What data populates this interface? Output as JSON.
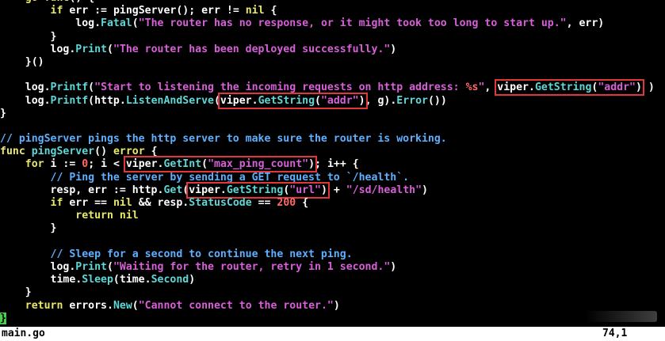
{
  "code_lines": [
    [
      {
        "t": "    ",
        "c": "plain"
      },
      {
        "t": "go",
        "c": "kw"
      },
      {
        "t": " ",
        "c": "plain"
      },
      {
        "t": "func",
        "c": "kw"
      },
      {
        "t": "() {",
        "c": "plain"
      }
    ],
    [
      {
        "t": "        ",
        "c": "plain"
      },
      {
        "t": "if",
        "c": "kw"
      },
      {
        "t": " err := ",
        "c": "plain"
      },
      {
        "t": "pingServer",
        "c": "plain"
      },
      {
        "t": "(); err != ",
        "c": "plain"
      },
      {
        "t": "nil",
        "c": "kw"
      },
      {
        "t": " {",
        "c": "plain"
      }
    ],
    [
      {
        "t": "            log.",
        "c": "plain"
      },
      {
        "t": "Fatal",
        "c": "fn"
      },
      {
        "t": "(",
        "c": "plain"
      },
      {
        "t": "\"The router has no response, or it might took too long to start up.\"",
        "c": "str"
      },
      {
        "t": ", err)",
        "c": "plain"
      }
    ],
    [
      {
        "t": "        }",
        "c": "plain"
      }
    ],
    [
      {
        "t": "        log.",
        "c": "plain"
      },
      {
        "t": "Print",
        "c": "fn"
      },
      {
        "t": "(",
        "c": "plain"
      },
      {
        "t": "\"The router has been deployed successfully.\"",
        "c": "str"
      },
      {
        "t": ")",
        "c": "plain"
      }
    ],
    [
      {
        "t": "    }()",
        "c": "plain"
      }
    ],
    [
      {
        "t": "",
        "c": "plain"
      }
    ],
    [
      {
        "t": "    log.",
        "c": "plain"
      },
      {
        "t": "Printf",
        "c": "fn"
      },
      {
        "t": "(",
        "c": "plain"
      },
      {
        "t": "\"Start to listening the incoming requests on http address: ",
        "c": "str"
      },
      {
        "t": "%s",
        "c": "fmt"
      },
      {
        "t": "\"",
        "c": "str"
      },
      {
        "t": ", ",
        "c": "plain"
      },
      {
        "t": "viper.",
        "c": "plain",
        "box": "start"
      },
      {
        "t": "GetString",
        "c": "fn"
      },
      {
        "t": "(",
        "c": "plain"
      },
      {
        "t": "\"addr\"",
        "c": "str"
      },
      {
        "t": ")",
        "c": "plain",
        "box": "end"
      },
      {
        "t": " )",
        "c": "plain"
      }
    ],
    [
      {
        "t": "    log.",
        "c": "plain"
      },
      {
        "t": "Printf",
        "c": "fn"
      },
      {
        "t": "(http.",
        "c": "plain"
      },
      {
        "t": "ListenAndServe",
        "c": "fn"
      },
      {
        "t": "(",
        "c": "plain"
      },
      {
        "t": "viper.",
        "c": "plain",
        "box": "start"
      },
      {
        "t": "GetString",
        "c": "fn"
      },
      {
        "t": "(",
        "c": "plain"
      },
      {
        "t": "\"addr\"",
        "c": "str"
      },
      {
        "t": ")",
        "c": "plain",
        "box": "end"
      },
      {
        "t": ", g).",
        "c": "plain"
      },
      {
        "t": "Error",
        "c": "fn"
      },
      {
        "t": "())",
        "c": "plain"
      }
    ],
    [
      {
        "t": "}",
        "c": "plain"
      }
    ],
    [
      {
        "t": "",
        "c": "plain"
      }
    ],
    [
      {
        "t": "// pingServer pings the http server to make sure the router is working.",
        "c": "cm"
      }
    ],
    [
      {
        "t": "func",
        "c": "kw"
      },
      {
        "t": " ",
        "c": "plain"
      },
      {
        "t": "pingServer",
        "c": "fn"
      },
      {
        "t": "() ",
        "c": "plain"
      },
      {
        "t": "error",
        "c": "kw"
      },
      {
        "t": " {",
        "c": "plain"
      }
    ],
    [
      {
        "t": "    ",
        "c": "plain"
      },
      {
        "t": "for",
        "c": "kw"
      },
      {
        "t": " i := ",
        "c": "plain"
      },
      {
        "t": "0",
        "c": "num"
      },
      {
        "t": "; i < ",
        "c": "plain"
      },
      {
        "t": "viper.",
        "c": "plain",
        "box": "start"
      },
      {
        "t": "GetInt",
        "c": "fn"
      },
      {
        "t": "(",
        "c": "plain"
      },
      {
        "t": "\"max_ping_count\"",
        "c": "str"
      },
      {
        "t": ")",
        "c": "plain",
        "box": "end"
      },
      {
        "t": "; i++ {",
        "c": "plain"
      }
    ],
    [
      {
        "t": "        ",
        "c": "plain"
      },
      {
        "t": "// Ping the server by sending a GET request to `/health`.",
        "c": "cm"
      }
    ],
    [
      {
        "t": "        resp, err := http.",
        "c": "plain"
      },
      {
        "t": "Get",
        "c": "fn"
      },
      {
        "t": "(",
        "c": "plain"
      },
      {
        "t": "viper.",
        "c": "plain",
        "box": "start"
      },
      {
        "t": "GetString",
        "c": "fn"
      },
      {
        "t": "(",
        "c": "plain"
      },
      {
        "t": "\"url\"",
        "c": "str"
      },
      {
        "t": ")",
        "c": "plain",
        "box": "end"
      },
      {
        "t": " + ",
        "c": "plain"
      },
      {
        "t": "\"/sd/health\"",
        "c": "str"
      },
      {
        "t": ")",
        "c": "plain"
      }
    ],
    [
      {
        "t": "        ",
        "c": "plain"
      },
      {
        "t": "if",
        "c": "kw"
      },
      {
        "t": " err == ",
        "c": "plain"
      },
      {
        "t": "nil",
        "c": "kw"
      },
      {
        "t": " && resp.",
        "c": "plain"
      },
      {
        "t": "StatusCode",
        "c": "fn"
      },
      {
        "t": " == ",
        "c": "plain"
      },
      {
        "t": "200",
        "c": "num"
      },
      {
        "t": " {",
        "c": "plain"
      }
    ],
    [
      {
        "t": "            ",
        "c": "plain"
      },
      {
        "t": "return",
        "c": "kw"
      },
      {
        "t": " ",
        "c": "plain"
      },
      {
        "t": "nil",
        "c": "kw"
      }
    ],
    [
      {
        "t": "        }",
        "c": "plain"
      }
    ],
    [
      {
        "t": "",
        "c": "plain"
      }
    ],
    [
      {
        "t": "        ",
        "c": "plain"
      },
      {
        "t": "// Sleep for a second to continue the next ping.",
        "c": "cm"
      }
    ],
    [
      {
        "t": "        log.",
        "c": "plain"
      },
      {
        "t": "Print",
        "c": "fn"
      },
      {
        "t": "(",
        "c": "plain"
      },
      {
        "t": "\"Waiting for the router, retry in 1 second.\"",
        "c": "str"
      },
      {
        "t": ")",
        "c": "plain"
      }
    ],
    [
      {
        "t": "        time.",
        "c": "plain"
      },
      {
        "t": "Sleep",
        "c": "fn"
      },
      {
        "t": "(time.",
        "c": "plain"
      },
      {
        "t": "Second",
        "c": "fn"
      },
      {
        "t": ")",
        "c": "plain"
      }
    ],
    [
      {
        "t": "    }",
        "c": "plain"
      }
    ],
    [
      {
        "t": "    ",
        "c": "plain"
      },
      {
        "t": "return",
        "c": "kw"
      },
      {
        "t": " errors.",
        "c": "plain"
      },
      {
        "t": "New",
        "c": "fn"
      },
      {
        "t": "(",
        "c": "plain"
      },
      {
        "t": "\"Cannot connect to the router.\"",
        "c": "str"
      },
      {
        "t": ")",
        "c": "plain"
      }
    ],
    [
      {
        "t": "}",
        "c": "plain",
        "cursor": true
      }
    ]
  ],
  "status_bar": {
    "filename": "main.go",
    "position": "74,1"
  },
  "colors": {
    "background": "#000000",
    "keyword": "#e8e86a",
    "function": "#5fd7d7",
    "string": "#d75fd7",
    "number": "#ff6a6a",
    "comment": "#5fafff",
    "highlight_box": "#e0373a",
    "cursor": "#4ad04a",
    "status_bg": "#ffffff"
  }
}
